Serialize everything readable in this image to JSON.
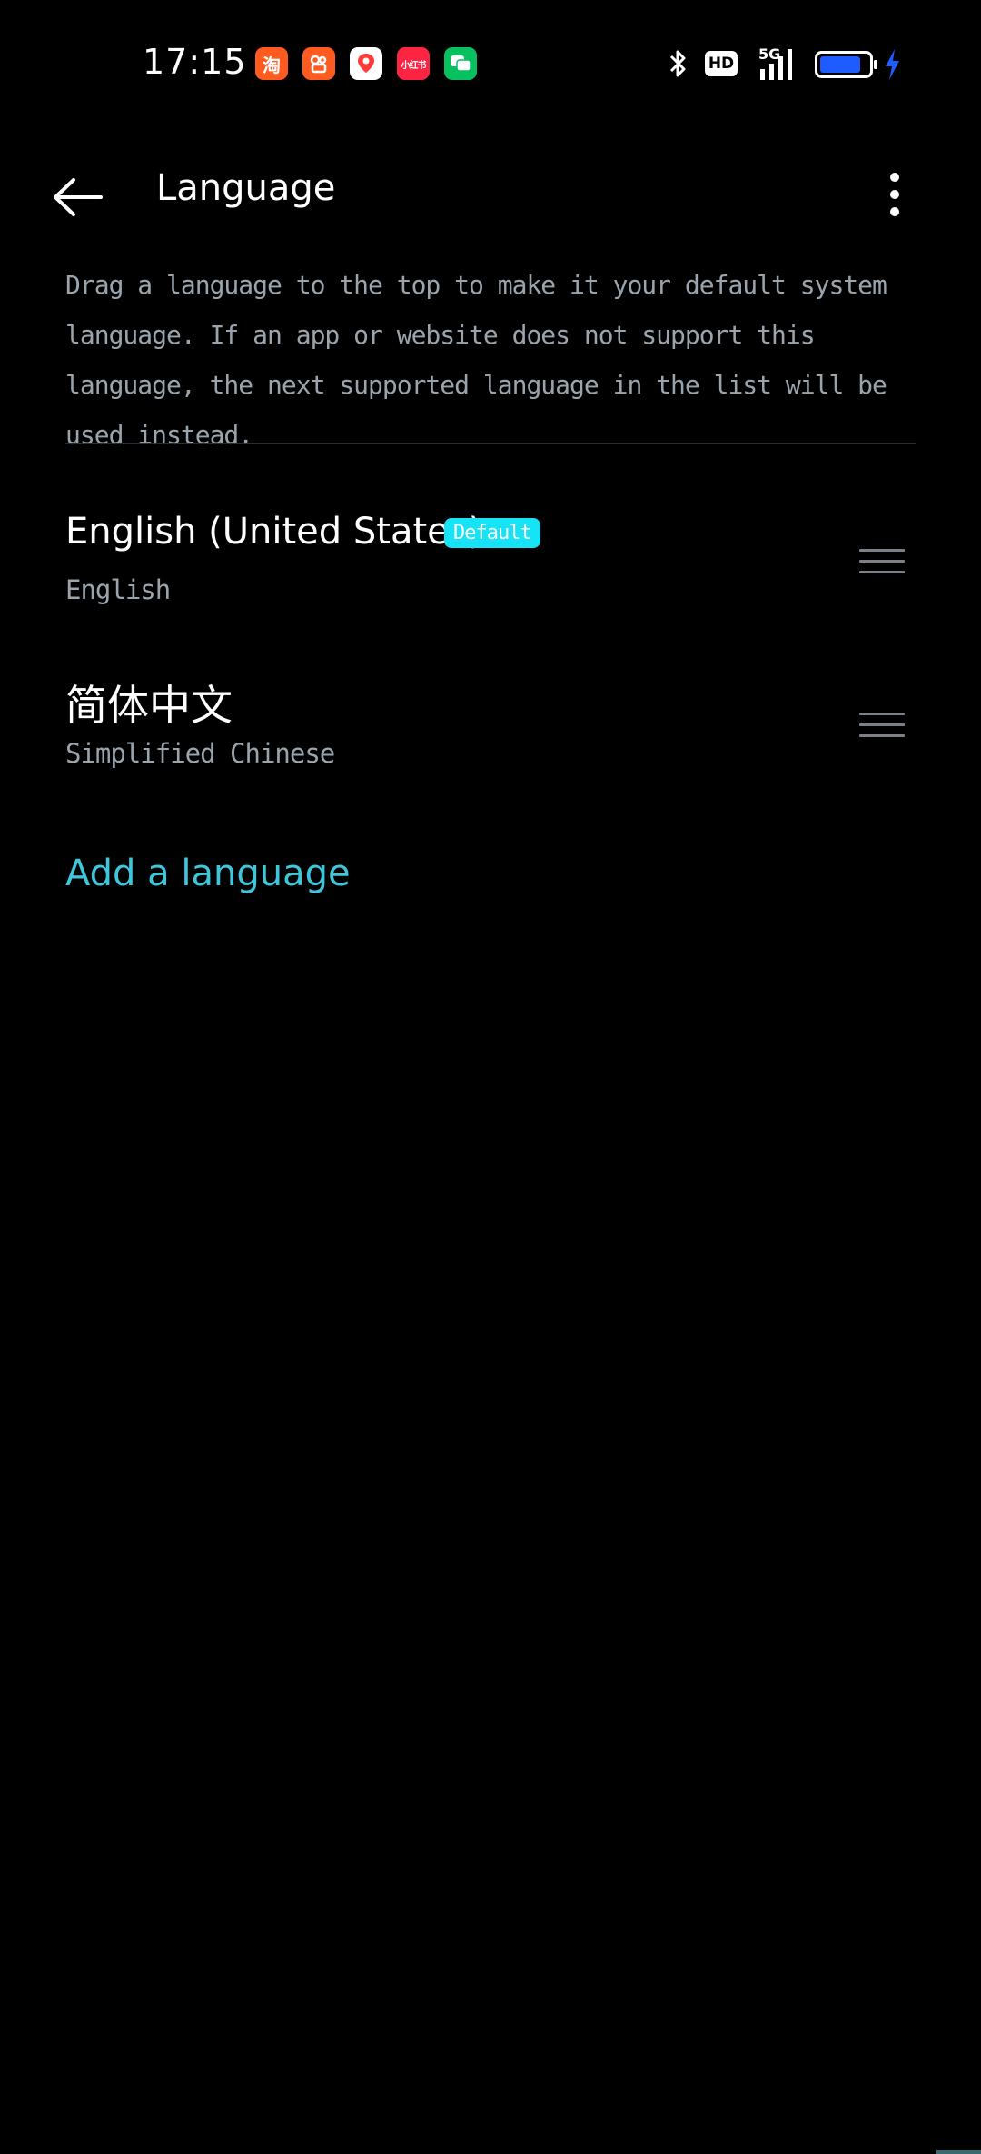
{
  "status_bar": {
    "time": "17:15",
    "notification_icons": [
      {
        "name": "taobao-icon",
        "label": "淘",
        "color": "#ff5a1f"
      },
      {
        "name": "kuaishou-icon",
        "label": "",
        "color": "#ff5a1f"
      },
      {
        "name": "maps-icon",
        "label": "",
        "color": "#ffffff"
      },
      {
        "name": "xiaohongshu-icon",
        "label": "小红书",
        "color": "#ff2442"
      },
      {
        "name": "messages-icon",
        "label": "",
        "color": "#07c160"
      }
    ],
    "hd_label": "HD",
    "network_label": "5G",
    "battery_color": "#1f5cff",
    "charging_color": "#1f5cff"
  },
  "toolbar": {
    "title": "Language"
  },
  "description": {
    "text": "Drag a language to the top to make it your default system language. If an app or website does not support this language, the next supported language in the list will be used instead."
  },
  "languages": [
    {
      "name": "English (United States)",
      "subtitle": "English",
      "badge": "Default"
    },
    {
      "name": "简体中文",
      "subtitle": "Simplified Chinese"
    }
  ],
  "add_language": {
    "label": "Add a language"
  },
  "colors": {
    "accent": "#3ec6db",
    "badge": "#16e3f5",
    "secondary_text": "#9aa4ad"
  }
}
